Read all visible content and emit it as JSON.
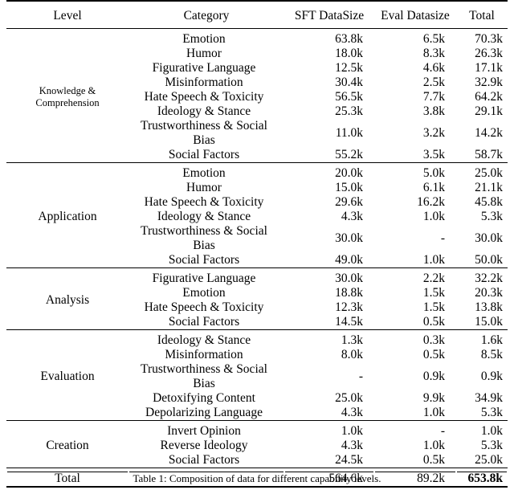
{
  "table": {
    "columns": [
      "Level",
      "Category",
      "SFT DataSize",
      "Eval Datasize",
      "Total"
    ],
    "blocks": [
      {
        "level": "Knowledge & Comprehension",
        "level_lines": [
          "Knowledge &",
          "Comprehension"
        ],
        "rows": [
          {
            "category": "Emotion",
            "sft": "63.8k",
            "eval": "6.5k",
            "total": "70.3k"
          },
          {
            "category": "Humor",
            "sft": "18.0k",
            "eval": "8.3k",
            "total": "26.3k"
          },
          {
            "category": "Figurative Language",
            "sft": "12.5k",
            "eval": "4.6k",
            "total": "17.1k"
          },
          {
            "category": "Misinformation",
            "sft": "30.4k",
            "eval": "2.5k",
            "total": "32.9k"
          },
          {
            "category": "Hate Speech & Toxicity",
            "sft": "56.5k",
            "eval": "7.7k",
            "total": "64.2k"
          },
          {
            "category": "Ideology & Stance",
            "sft": "25.3k",
            "eval": "3.8k",
            "total": "29.1k"
          },
          {
            "category": "Trustworthiness & Social Bias",
            "sft": "11.0k",
            "eval": "3.2k",
            "total": "14.2k"
          },
          {
            "category": "Social Factors",
            "sft": "55.2k",
            "eval": "3.5k",
            "total": "58.7k"
          }
        ]
      },
      {
        "level": "Application",
        "level_lines": [
          "Application"
        ],
        "rows": [
          {
            "category": "Emotion",
            "sft": "20.0k",
            "eval": "5.0k",
            "total": "25.0k"
          },
          {
            "category": "Humor",
            "sft": "15.0k",
            "eval": "6.1k",
            "total": "21.1k"
          },
          {
            "category": "Hate Speech & Toxicity",
            "sft": "29.6k",
            "eval": "16.2k",
            "total": "45.8k"
          },
          {
            "category": "Ideology & Stance",
            "sft": "4.3k",
            "eval": "1.0k",
            "total": "5.3k"
          },
          {
            "category": "Trustworthiness & Social Bias",
            "sft": "30.0k",
            "eval": "-",
            "total": "30.0k"
          },
          {
            "category": "Social Factors",
            "sft": "49.0k",
            "eval": "1.0k",
            "total": "50.0k"
          }
        ]
      },
      {
        "level": "Analysis",
        "level_lines": [
          "Analysis"
        ],
        "rows": [
          {
            "category": "Figurative Language",
            "sft": "30.0k",
            "eval": "2.2k",
            "total": "32.2k"
          },
          {
            "category": "Emotion",
            "sft": "18.8k",
            "eval": "1.5k",
            "total": "20.3k"
          },
          {
            "category": "Hate Speech & Toxicity",
            "sft": "12.3k",
            "eval": "1.5k",
            "total": "13.8k"
          },
          {
            "category": "Social Factors",
            "sft": "14.5k",
            "eval": "0.5k",
            "total": "15.0k"
          }
        ]
      },
      {
        "level": "Evaluation",
        "level_lines": [
          "Evaluation"
        ],
        "rows": [
          {
            "category": "Ideology & Stance",
            "sft": "1.3k",
            "eval": "0.3k",
            "total": "1.6k"
          },
          {
            "category": "Misinformation",
            "sft": "8.0k",
            "eval": "0.5k",
            "total": "8.5k"
          },
          {
            "category": "Trustworthiness & Social Bias",
            "sft": "-",
            "eval": "0.9k",
            "total": "0.9k"
          },
          {
            "category": "Detoxifying Content",
            "sft": "25.0k",
            "eval": "9.9k",
            "total": "34.9k"
          },
          {
            "category": "Depolarizing Language",
            "sft": "4.3k",
            "eval": "1.0k",
            "total": "5.3k"
          }
        ]
      },
      {
        "level": "Creation",
        "level_lines": [
          "Creation"
        ],
        "rows": [
          {
            "category": "Invert Opinion",
            "sft": "1.0k",
            "eval": "-",
            "total": "1.0k"
          },
          {
            "category": "Reverse Ideology",
            "sft": "4.3k",
            "eval": "1.0k",
            "total": "5.3k"
          },
          {
            "category": "Social Factors",
            "sft": "24.5k",
            "eval": "0.5k",
            "total": "25.0k"
          }
        ]
      }
    ],
    "total_row": {
      "label": "Total",
      "category": "",
      "sft": "564.6k",
      "eval": "89.2k",
      "total": "653.8k"
    }
  },
  "caption": {
    "text": "Table 1: Composition of data for different capability levels."
  }
}
